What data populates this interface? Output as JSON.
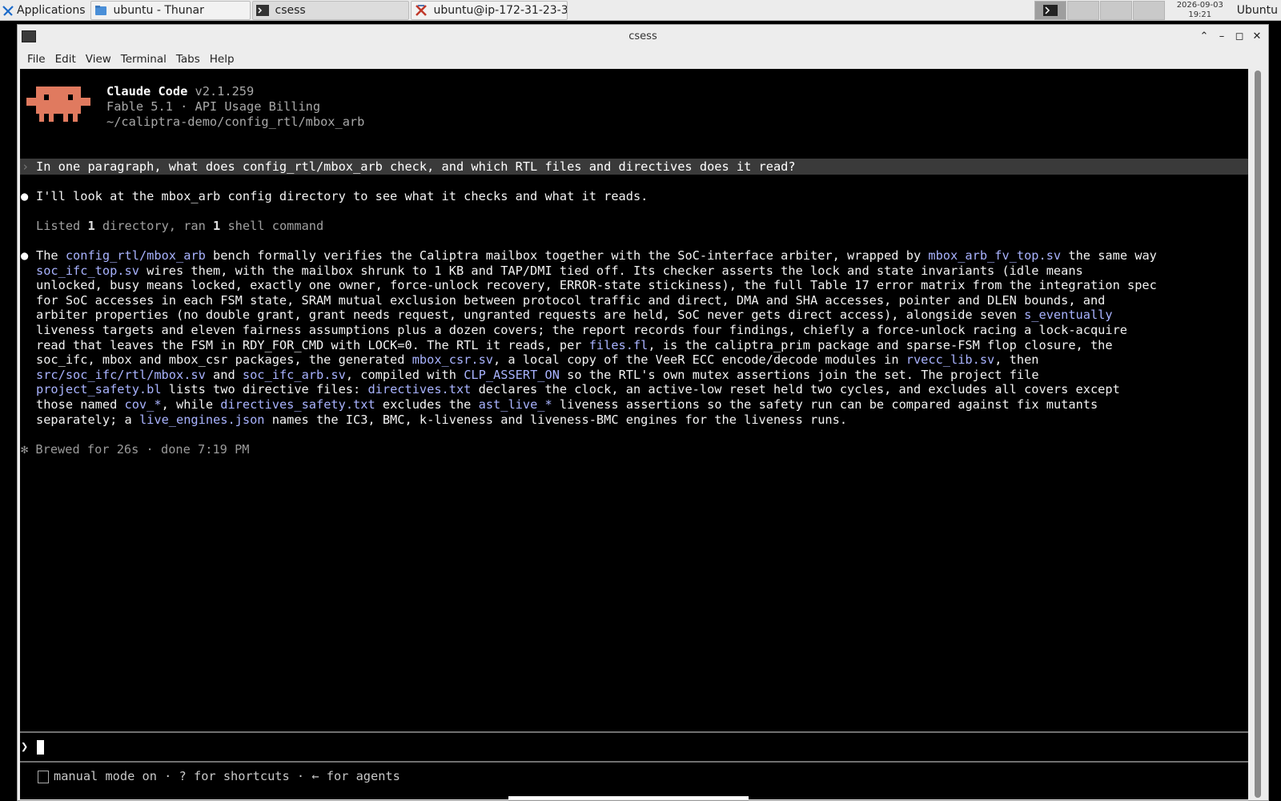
{
  "panel": {
    "applications_label": "Applications",
    "tasks": [
      {
        "label": "ubuntu - Thunar",
        "icon": "folder-icon"
      },
      {
        "label": "csess",
        "icon": "terminal-icon"
      },
      {
        "label": "ubuntu@ip-172-31-23-3...",
        "icon": "x-terminal-icon"
      }
    ],
    "clock_date": "2026-09-03",
    "clock_time": "19:21",
    "user": "Ubuntu"
  },
  "window": {
    "title": "csess",
    "menu": [
      "File",
      "Edit",
      "View",
      "Terminal",
      "Tabs",
      "Help"
    ]
  },
  "terminal": {
    "header": {
      "app_name": "Claude Code",
      "version": "v2.1.259",
      "model_line": "Fable 5.1 · API Usage Billing",
      "cwd": "~/caliptra-demo/config_rtl/mbox_arb"
    },
    "prompt_chevron": "›",
    "user_prompt": "In one paragraph, what does config_rtl/mbox_arb check, and which RTL files and directives does it read?",
    "bullet": "●",
    "message1": "I'll look at the mbox_arb config directory to see what it checks and what it reads.",
    "listed": {
      "pre": "Listed ",
      "n1": "1",
      "mid": " directory, ran ",
      "n2": "1",
      "post": " shell command"
    },
    "answer_lines": [
      [
        {
          "t": "The "
        },
        {
          "t": "config_rtl/mbox_arb",
          "link": true
        },
        {
          "t": " bench formally verifies the Caliptra mailbox together with the SoC-interface arbiter, wrapped by "
        },
        {
          "t": "mbox_arb_fv_top.sv",
          "link": true
        },
        {
          "t": " the same way"
        }
      ],
      [
        {
          "t": "soc_ifc_top.sv",
          "link": true
        },
        {
          "t": " wires them, with the mailbox shrunk to 1 KB and TAP/DMI tied off. Its checker asserts the lock and state invariants (idle means"
        }
      ],
      [
        {
          "t": "unlocked, busy means locked, exactly one owner, force-unlock recovery, ERROR-state stickiness), the full Table 17 error matrix from the integration spec"
        }
      ],
      [
        {
          "t": "for SoC accesses in each FSM state, SRAM mutual exclusion between protocol traffic and direct, DMA and SHA accesses, pointer and DLEN bounds, and"
        }
      ],
      [
        {
          "t": "arbiter properties (no double grant, grant needs request, ungranted requests are held, SoC never gets direct access), alongside seven "
        },
        {
          "t": "s_eventually",
          "link": true
        }
      ],
      [
        {
          "t": "liveness targets and eleven fairness assumptions plus a dozen covers; the report records four findings, chiefly a force-unlock racing a lock-acquire"
        }
      ],
      [
        {
          "t": "read that leaves the FSM in RDY_FOR_CMD with LOCK=0. The RTL it reads, per "
        },
        {
          "t": "files.fl",
          "link": true
        },
        {
          "t": ", is the caliptra_prim package and sparse-FSM flop closure, the"
        }
      ],
      [
        {
          "t": "soc_ifc, mbox and mbox_csr packages, the generated "
        },
        {
          "t": "mbox_csr.sv",
          "link": true
        },
        {
          "t": ", a local copy of the VeeR ECC encode/decode modules in "
        },
        {
          "t": "rvecc_lib.sv",
          "link": true
        },
        {
          "t": ", then"
        }
      ],
      [
        {
          "t": "src/soc_ifc/rtl/mbox.sv",
          "link": true
        },
        {
          "t": " and "
        },
        {
          "t": "soc_ifc_arb.sv",
          "link": true
        },
        {
          "t": ", compiled with "
        },
        {
          "t": "CLP_ASSERT_ON",
          "link": true
        },
        {
          "t": " so the RTL's own mutex assertions join the set. The project file"
        }
      ],
      [
        {
          "t": "project_safety.bl",
          "link": true
        },
        {
          "t": " lists two directive files: "
        },
        {
          "t": "directives.txt",
          "link": true
        },
        {
          "t": " declares the clock, an active-low reset held two cycles, and excludes all covers except"
        }
      ],
      [
        {
          "t": "those named "
        },
        {
          "t": "cov_*",
          "link": true
        },
        {
          "t": ", while "
        },
        {
          "t": "directives_safety.txt",
          "link": true
        },
        {
          "t": " excludes the "
        },
        {
          "t": "ast_live_*",
          "link": true
        },
        {
          "t": " liveness assertions so the safety run can be compared against fix mutants"
        }
      ],
      [
        {
          "t": "separately; a "
        },
        {
          "t": "live_engines.json",
          "link": true
        },
        {
          "t": " names the IC3, BMC, k-liveness and liveness-BMC engines for the liveness runs."
        }
      ]
    ],
    "brewed": "✻ Brewed for 26s · done 7:19 PM",
    "input_chevron": "❯",
    "status_text": "manual mode on · ? for shortcuts · ← for agents",
    "accent_link": "#a9b3ff",
    "logo_color": "#e07a5f"
  }
}
